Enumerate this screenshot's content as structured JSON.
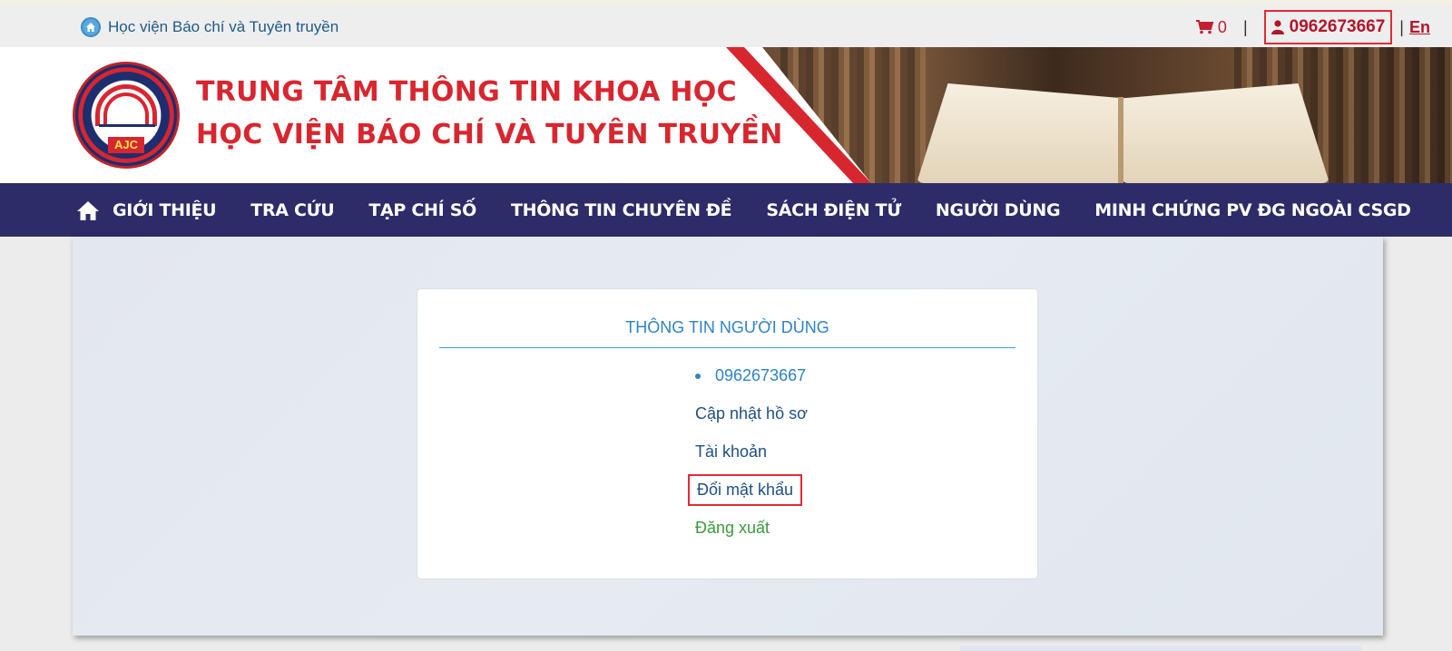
{
  "topbar": {
    "home_link": "Học viện Báo chí và Tuyên truyền",
    "cart_count": "0",
    "separator": "|",
    "username": "0962673667",
    "lang": "En"
  },
  "header": {
    "line1": "TRUNG TÂM THÔNG TIN KHOA HỌC",
    "line2": "HỌC VIỆN BÁO CHÍ VÀ TUYÊN TRUYỀN",
    "logo_text": "AJC"
  },
  "nav": {
    "items": [
      "GIỚI THIỆU",
      "TRA CỨU",
      "TẠP CHÍ SỐ",
      "THÔNG TIN CHUYÊN ĐỀ",
      "SÁCH ĐIỆN TỬ",
      "NGƯỜI DÙNG",
      "MINH CHỨNG PV ĐG NGOÀI CSGD"
    ]
  },
  "user_card": {
    "title": "THÔNG TIN NGƯỜI DÙNG",
    "phone": "0962673667",
    "update_profile": "Cập nhật hồ sơ",
    "account": "Tài khoản",
    "change_password": "Đổi mật khẩu",
    "logout": "Đăng xuất"
  },
  "colors": {
    "brand_red": "#d8262f",
    "nav_bg": "#2e2b69",
    "link_blue": "#2e82c8",
    "logout_green": "#3a9a3c",
    "highlight_border": "#e32b34"
  }
}
